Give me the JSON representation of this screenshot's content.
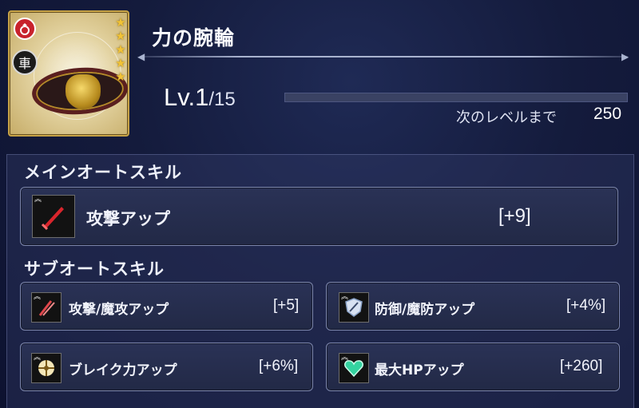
{
  "item": {
    "name": "力の腕輪",
    "rarity_stars": 5,
    "type_badge": "accessory-ring",
    "element_badge": "車"
  },
  "level": {
    "prefix": "Lv.",
    "current": "1",
    "max": "/15",
    "progress_fraction": 0.0,
    "next_label": "次のレベルまで",
    "next_value": "250"
  },
  "main_auto_skill": {
    "title": "メインオートスキル",
    "skill": {
      "name": "攻撃アップ",
      "value": "[+9]",
      "icon": "red-sword-icon"
    }
  },
  "sub_auto_skill": {
    "title": "サブオートスキル",
    "skills": [
      {
        "name": "攻撃/魔攻アップ",
        "value": "[+5]",
        "icon": "sword-staff-icon"
      },
      {
        "name": "防御/魔防アップ",
        "value": "[+4%]",
        "icon": "shield-icon"
      },
      {
        "name": "ブレイク力アップ",
        "value": "[+6%]",
        "icon": "break-icon"
      },
      {
        "name": "最大HPアップ",
        "value": "[+260]",
        "icon": "heart-icon"
      }
    ]
  },
  "colors": {
    "star": "#f2c336",
    "card_border": "#7c86ad",
    "background": "#141b3c"
  }
}
